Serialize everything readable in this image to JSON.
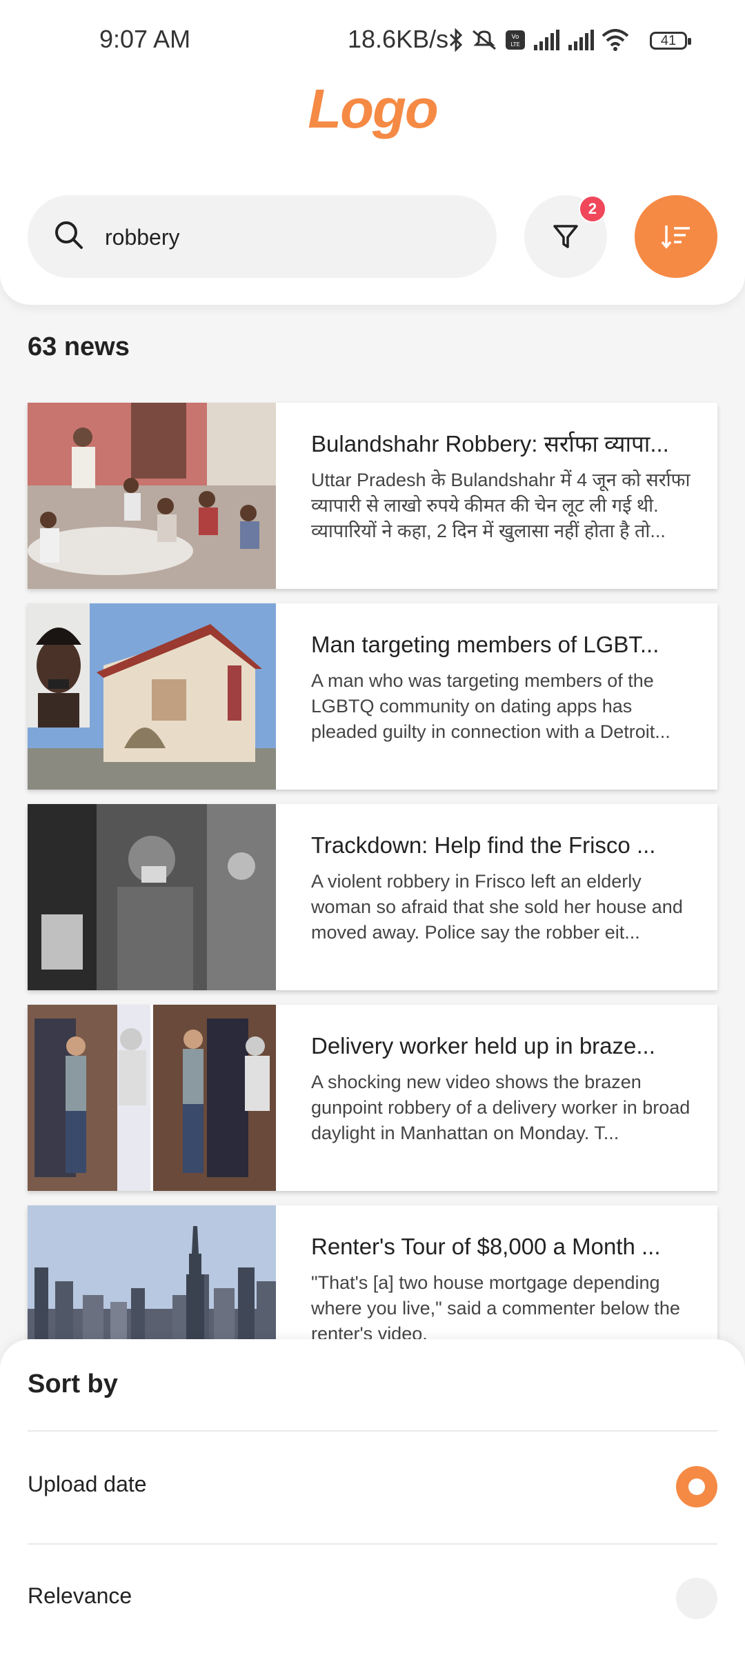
{
  "status": {
    "time": "9:07 AM",
    "net_speed": "18.6KB/s",
    "battery": "41"
  },
  "header": {
    "logo": "Logo"
  },
  "search": {
    "value": "robbery",
    "placeholder": ""
  },
  "filter": {
    "badge_count": "2"
  },
  "results": {
    "count_label": "63 news"
  },
  "news": [
    {
      "title": "Bulandshahr Robbery: सर्राफा व्यापा...",
      "description": "Uttar Pradesh के Bulandshahr में 4 जून को सर्राफा व्यापारी से लाखो रुपये कीमत की चेन लूट ली गई थी. व्यापारियों ने कहा, 2 दिन में खुलासा नहीं होता है तो..."
    },
    {
      "title": "Man targeting members of LGBT...",
      "description": "A man who was targeting members of the LGBTQ community on dating apps has pleaded guilty in connection with a Detroit..."
    },
    {
      "title": "Trackdown: Help find the Frisco ...",
      "description": "A violent robbery in Frisco left an elderly woman so afraid that she sold her house and moved away. Police say the robber eit..."
    },
    {
      "title": "Delivery worker held up in braze...",
      "description": "A shocking new video shows the brazen gunpoint robbery of a delivery worker in broad daylight in Manhattan on Monday. T..."
    },
    {
      "title": "Renter's Tour of $8,000 a Month ...",
      "description": "\"That's [a] two house mortgage depending where you live,\" said a commenter below the renter's video."
    }
  ],
  "sort_sheet": {
    "title": "Sort by",
    "options": [
      {
        "label": "Upload date",
        "selected": true
      },
      {
        "label": "Relevance",
        "selected": false
      }
    ]
  },
  "colors": {
    "accent": "#f58a45",
    "badge": "#f0475a"
  }
}
